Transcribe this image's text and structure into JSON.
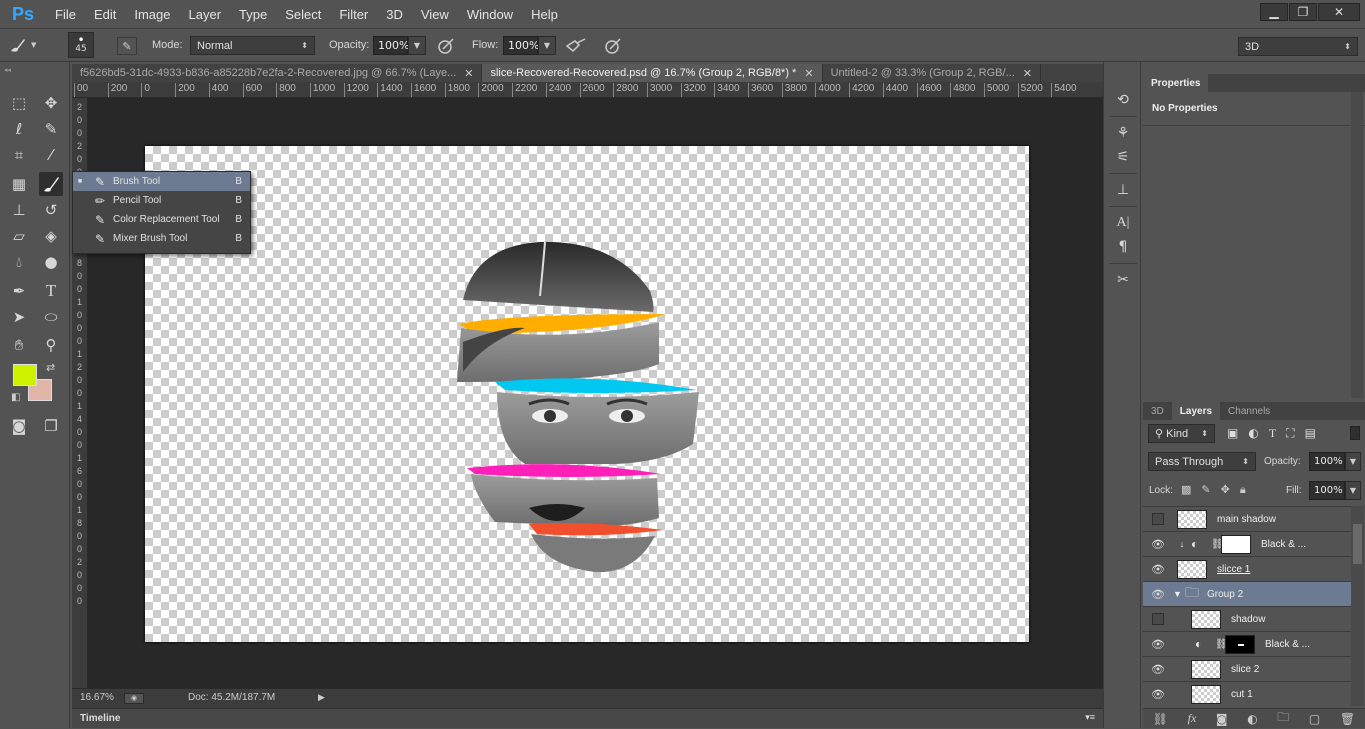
{
  "app": {
    "logo": "Ps"
  },
  "menu": [
    "File",
    "Edit",
    "Image",
    "Layer",
    "Type",
    "Select",
    "Filter",
    "3D",
    "View",
    "Window",
    "Help"
  ],
  "window_controls": {
    "minimize": "▁",
    "restore": "❐",
    "close": "✕"
  },
  "options_bar": {
    "brush_size": "45",
    "mode_label": "Mode:",
    "mode_value": "Normal",
    "opacity_label": "Opacity:",
    "opacity_value": "100%",
    "flow_label": "Flow:",
    "flow_value": "100%",
    "workspace": "3D"
  },
  "tabs": [
    {
      "label": "f5626bd5-31dc-4933-b836-a85228b7e2fa-2-Recovered.jpg @ 66.7% (Laye...",
      "close": "✕",
      "active": false
    },
    {
      "label": "slice-Recovered-Recovered.psd @ 16.7% (Group 2, RGB/8*) *",
      "close": "✕",
      "active": true
    },
    {
      "label": "Untitled-2 @ 33.3% (Group 2, RGB/...",
      "close": "✕",
      "active": false
    }
  ],
  "ruler_h": [
    "00",
    "200",
    "0",
    "200",
    "400",
    "600",
    "800",
    "1000",
    "1200",
    "1400",
    "1600",
    "1800",
    "2000",
    "2200",
    "2400",
    "2600",
    "2800",
    "3000",
    "3200",
    "3400",
    "3600",
    "3800",
    "4000",
    "4200",
    "4400",
    "4600",
    "4800",
    "5000",
    "5200",
    "5400"
  ],
  "ruler_v": [
    "2",
    "0",
    "0",
    "2",
    "0",
    "0",
    "4",
    "0",
    "0",
    "6",
    "0",
    "0",
    "8",
    "0",
    "0",
    "1",
    "0",
    "0",
    "0",
    "1",
    "2",
    "0",
    "0",
    "1",
    "4",
    "0",
    "0",
    "1",
    "6",
    "0",
    "0",
    "1",
    "8",
    "0",
    "0",
    "2",
    "0",
    "0",
    "0"
  ],
  "flyout": [
    {
      "label": "Brush Tool",
      "shortcut": "B",
      "selected": true,
      "icon": "brush-icon"
    },
    {
      "label": "Pencil Tool",
      "shortcut": "B",
      "selected": false,
      "icon": "pencil-icon"
    },
    {
      "label": "Color Replacement Tool",
      "shortcut": "B",
      "selected": false,
      "icon": "color-replacement-icon"
    },
    {
      "label": "Mixer Brush Tool",
      "shortcut": "B",
      "selected": false,
      "icon": "mixer-brush-icon"
    }
  ],
  "colors": {
    "foreground": "#ccf200",
    "background": "#e0b4a6",
    "accent": "#6c7b91",
    "stripe_orange": "#ffae00",
    "stripe_cyan": "#00c8f0",
    "stripe_magenta": "#ff1fb9",
    "stripe_red": "#f0502e"
  },
  "status": {
    "zoom": "16.67%",
    "doc": "Doc: 45.2M/187.7M"
  },
  "timeline": {
    "label": "Timeline"
  },
  "properties": {
    "tab": "Properties",
    "content": "No Properties"
  },
  "layers_panel": {
    "tabs": [
      "3D",
      "Layers",
      "Channels"
    ],
    "active_tab": "Layers",
    "filter_kind": "Kind",
    "blend_mode": "Pass Through",
    "opacity_label": "Opacity:",
    "opacity_value": "100%",
    "lock_label": "Lock:",
    "fill_label": "Fill:",
    "fill_value": "100%",
    "layers": [
      {
        "name": "main shadow",
        "visible": false,
        "type": "pixel",
        "indent": 0
      },
      {
        "name": "Black & ...",
        "visible": true,
        "type": "adjustment",
        "indent": 0,
        "clipped": true,
        "mask": "white"
      },
      {
        "name": "slicce 1",
        "visible": true,
        "type": "pixel",
        "indent": 0,
        "underline": true
      },
      {
        "name": "Group 2",
        "visible": true,
        "type": "group",
        "indent": 0,
        "selected": true
      },
      {
        "name": "shadow",
        "visible": false,
        "type": "pixel",
        "indent": 1
      },
      {
        "name": "Black & ...",
        "visible": true,
        "type": "adjustment",
        "indent": 1,
        "mask": "black"
      },
      {
        "name": "slice 2",
        "visible": true,
        "type": "pixel",
        "indent": 1
      },
      {
        "name": "cut 1",
        "visible": true,
        "type": "pixel",
        "indent": 1
      }
    ]
  }
}
